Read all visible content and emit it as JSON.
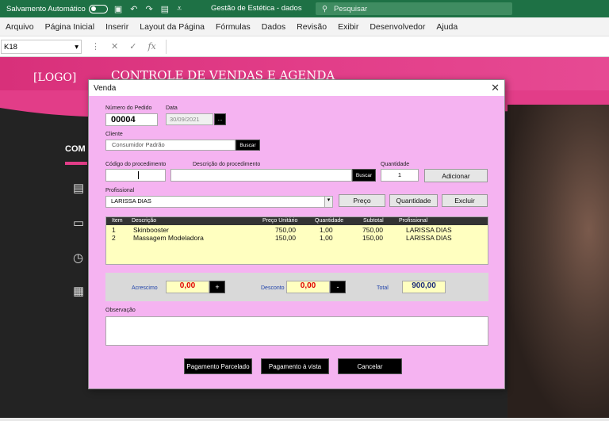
{
  "titlebar": {
    "autosave_label": "Salvamento Automático",
    "document_title": "Gestão de Estética - dados",
    "search_placeholder": "Pesquisar"
  },
  "menu": [
    "Arquivo",
    "Página Inicial",
    "Inserir",
    "Layout da Página",
    "Fórmulas",
    "Dados",
    "Revisão",
    "Exibir",
    "Desenvolvedor",
    "Ajuda"
  ],
  "formula_bar": {
    "cell_ref": "K18",
    "fx_label": "fx"
  },
  "sheet": {
    "logo_text": "[LOGO]",
    "banner_title": "CONTROLE DE VENDAS E  AGENDA",
    "side_label": "COM"
  },
  "dialog": {
    "title": "Venda",
    "order_label": "Número do Pedido",
    "order_value": "00004",
    "date_label": "Data",
    "date_value": "30/09/2021",
    "date_button": "...",
    "client_label": "Cliente",
    "client_value": "Consumidor Padrão",
    "client_search": "Buscar",
    "proc_code_label": "Código do procedimento",
    "proc_desc_label": "Descrição do  procedimento",
    "proc_search": "Buscar",
    "qty_label": "Quantidade",
    "qty_value": "1",
    "add_button": "Adicionar",
    "professional_label": "Profissional",
    "professional_value": "LARISSA DIAS",
    "price_button": "Preço",
    "quantity_button": "Quantidade",
    "delete_button": "Excluir",
    "grid": {
      "headers": [
        "Item",
        "Descrição",
        "Preço Unitário",
        "Quantidade",
        "Subtotal",
        "Profissional"
      ],
      "rows": [
        [
          "1",
          "Skinbooster",
          "750,00",
          "1,00",
          "750,00",
          "LARISSA DIAS"
        ],
        [
          "2",
          "Massagem Modeladora",
          "150,00",
          "1,00",
          "150,00",
          "LARISSA DIAS"
        ]
      ]
    },
    "addition_label": "Acrescimo",
    "addition_value": "0,00",
    "addition_btn": "+",
    "discount_label": "Desconto",
    "discount_value": "0,00",
    "discount_btn": "-",
    "total_label": "Total",
    "total_value": "900,00",
    "notes_label": "Observação",
    "pay_installments": "Pagamento Parcelado",
    "pay_cash": "Pagamento à vista",
    "cancel": "Cancelar"
  }
}
